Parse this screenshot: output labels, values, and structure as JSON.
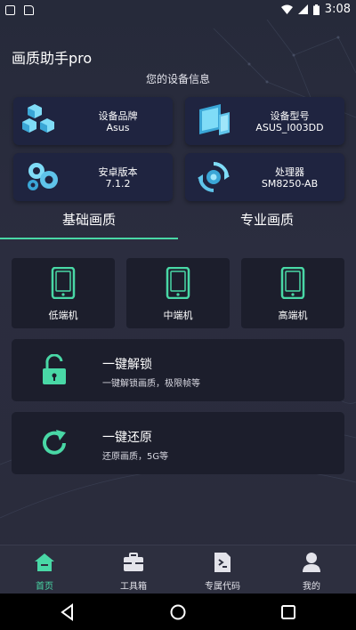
{
  "status": {
    "time": "3:08"
  },
  "app": {
    "title": "画质助手pro"
  },
  "device_section": {
    "title": "您的设备信息"
  },
  "device_info": [
    {
      "label": "设备品牌",
      "value": "Asus",
      "icon": "cubes-icon"
    },
    {
      "label": "设备型号",
      "value": "ASUS_I003DD",
      "icon": "devices-icon"
    },
    {
      "label": "安卓版本",
      "value": "7.1.2",
      "icon": "gears-icon"
    },
    {
      "label": "处理器",
      "value": "SM8250-AB",
      "icon": "processor-icon"
    }
  ],
  "tabs": [
    {
      "label": "基础画质",
      "active": true
    },
    {
      "label": "专业画质",
      "active": false
    }
  ],
  "tiers": [
    {
      "label": "低端机"
    },
    {
      "label": "中端机"
    },
    {
      "label": "高端机"
    }
  ],
  "actions": [
    {
      "title": "一键解锁",
      "desc": "一键解锁画质，极限帧等",
      "icon": "unlock-icon"
    },
    {
      "title": "一键还原",
      "desc": "还原画质，5G等",
      "icon": "refresh-icon"
    }
  ],
  "bottom_nav": [
    {
      "label": "首页",
      "icon": "home-icon",
      "active": true
    },
    {
      "label": "工具箱",
      "icon": "toolbox-icon",
      "active": false
    },
    {
      "label": "专属代码",
      "icon": "code-file-icon",
      "active": false
    },
    {
      "label": "我的",
      "icon": "profile-icon",
      "active": false
    }
  ],
  "colors": {
    "accent": "#49d8a6",
    "card": "#1f2440",
    "tile": "#1c1e2c",
    "background": "#2a2b3b"
  }
}
